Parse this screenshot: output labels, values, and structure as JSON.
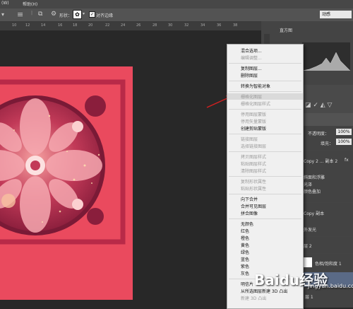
{
  "menubar": {
    "view": "(W)",
    "help": "帮助(H)"
  },
  "options": {
    "shape_label": "形状：",
    "align_edges_label": "对齐边缘",
    "workspace": "动感"
  },
  "ruler": {
    "ticks": [
      "10",
      "12",
      "14",
      "16",
      "18",
      "20",
      "22",
      "24",
      "26",
      "28",
      "30",
      "32",
      "34",
      "36",
      "38"
    ]
  },
  "panels": {
    "histogram_title": "直方图",
    "opacity_label": "不透明度：",
    "opacity_value": "100%",
    "fill_label": "填充：",
    "fill_value": "100%",
    "layers": [
      "Copy 2 ... 副本 2",
      "fx",
      "斜面和浮雕",
      "光泽",
      "颜色叠加",
      "Copy 副本",
      "外发光",
      "层 2",
      "色相/饱和度 1",
      "层 1",
      "层 1"
    ]
  },
  "context_menu": {
    "items": [
      {
        "label": "混合选项...",
        "disabled": false
      },
      {
        "label": "编辑调整...",
        "disabled": true
      },
      {
        "sep": true
      },
      {
        "label": "复制图层...",
        "disabled": false
      },
      {
        "label": "删除图层",
        "disabled": false
      },
      {
        "sep": true
      },
      {
        "label": "转换为智能对象",
        "disabled": false
      },
      {
        "sep": true
      },
      {
        "label": "栅格化图层",
        "disabled": true,
        "highlighted": true
      },
      {
        "label": "栅格化图层样式",
        "disabled": true
      },
      {
        "sep": true
      },
      {
        "label": "停用图层蒙版",
        "disabled": true
      },
      {
        "label": "停用矢量蒙版",
        "disabled": true
      },
      {
        "label": "创建剪贴蒙版",
        "disabled": false
      },
      {
        "sep": true
      },
      {
        "label": "链接图层",
        "disabled": true
      },
      {
        "label": "选择链接图层",
        "disabled": true
      },
      {
        "sep": true
      },
      {
        "label": "拷贝图层样式",
        "disabled": true
      },
      {
        "label": "粘贴图层样式",
        "disabled": true
      },
      {
        "label": "清除图层样式",
        "disabled": true
      },
      {
        "sep": true
      },
      {
        "label": "复制形状属性",
        "disabled": true
      },
      {
        "label": "粘贴形状属性",
        "disabled": true
      },
      {
        "sep": true
      },
      {
        "label": "向下合并",
        "disabled": false
      },
      {
        "label": "合并可见图层",
        "disabled": false
      },
      {
        "label": "拼合图像",
        "disabled": false
      },
      {
        "sep": true
      },
      {
        "label": "无颜色",
        "disabled": false
      },
      {
        "label": "红色",
        "disabled": false
      },
      {
        "label": "橙色",
        "disabled": false
      },
      {
        "label": "黄色",
        "disabled": false
      },
      {
        "label": "绿色",
        "disabled": false
      },
      {
        "label": "蓝色",
        "disabled": false
      },
      {
        "label": "紫色",
        "disabled": false
      },
      {
        "label": "灰色",
        "disabled": false
      },
      {
        "sep": true
      },
      {
        "label": "明信片",
        "disabled": false
      },
      {
        "label": "从所选图层新建 3D 凸出",
        "disabled": false
      },
      {
        "label": "新建 3D 凸出",
        "disabled": true
      }
    ]
  },
  "watermark": {
    "logo": "Baidu经验",
    "url": "jingyan.baidu.com"
  },
  "colors": {
    "artwork": "#ea4a5e",
    "frame": "#c22a48",
    "dark_art": "#7a1a36",
    "arrow": "#d42020"
  }
}
